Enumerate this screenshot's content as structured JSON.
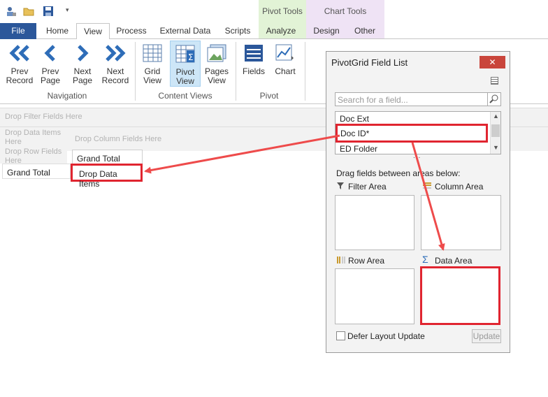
{
  "context_tabs": {
    "pivot_tools": "Pivot Tools",
    "chart_tools": "Chart Tools"
  },
  "tabs": [
    "File",
    "Home",
    "View",
    "Process",
    "External Data",
    "Scripts",
    "Analyze",
    "Design",
    "Other"
  ],
  "ribbon": {
    "buttons": [
      {
        "label1": "Prev",
        "label2": "Record"
      },
      {
        "label1": "Prev",
        "label2": "Page"
      },
      {
        "label1": "Next",
        "label2": "Page"
      },
      {
        "label1": "Next",
        "label2": "Record"
      },
      {
        "label1": "Grid",
        "label2": "View"
      },
      {
        "label1": "Pivot",
        "label2": "View"
      },
      {
        "label1": "Pages",
        "label2": "View"
      },
      {
        "label1": "Fields",
        "label2": ""
      },
      {
        "label1": "Chart",
        "label2": ""
      }
    ],
    "groups": {
      "navigation": "Navigation",
      "content_views": "Content Views",
      "pivot": "Pivot"
    }
  },
  "pivot": {
    "filter_placeholder": "Drop Filter Fields Here",
    "data_items_placeholder": "Drop Data Items Here",
    "row_placeholder": "Drop Row Fields Here",
    "column_placeholder": "Drop Column Fields Here",
    "grand_total_col": "Grand Total",
    "drop_data_items": "Drop Data Items",
    "grand_total_row": "Grand Total"
  },
  "field_list": {
    "title": "PivotGrid Field List",
    "search_placeholder": "Search for a field...",
    "fields": [
      "Doc Ext",
      "Doc ID*",
      "ED Folder"
    ],
    "more": "...",
    "instructions": "Drag fields between areas below:",
    "filter_area": "Filter Area",
    "column_area": "Column Area",
    "row_area": "Row Area",
    "data_area": "Data Area",
    "defer_label": "Defer Layout Update",
    "update_button": "Update",
    "defer_checked": false
  },
  "colors": {
    "accent": "#2b579a",
    "highlight": "#e02530",
    "selected": "#cde6f7"
  }
}
